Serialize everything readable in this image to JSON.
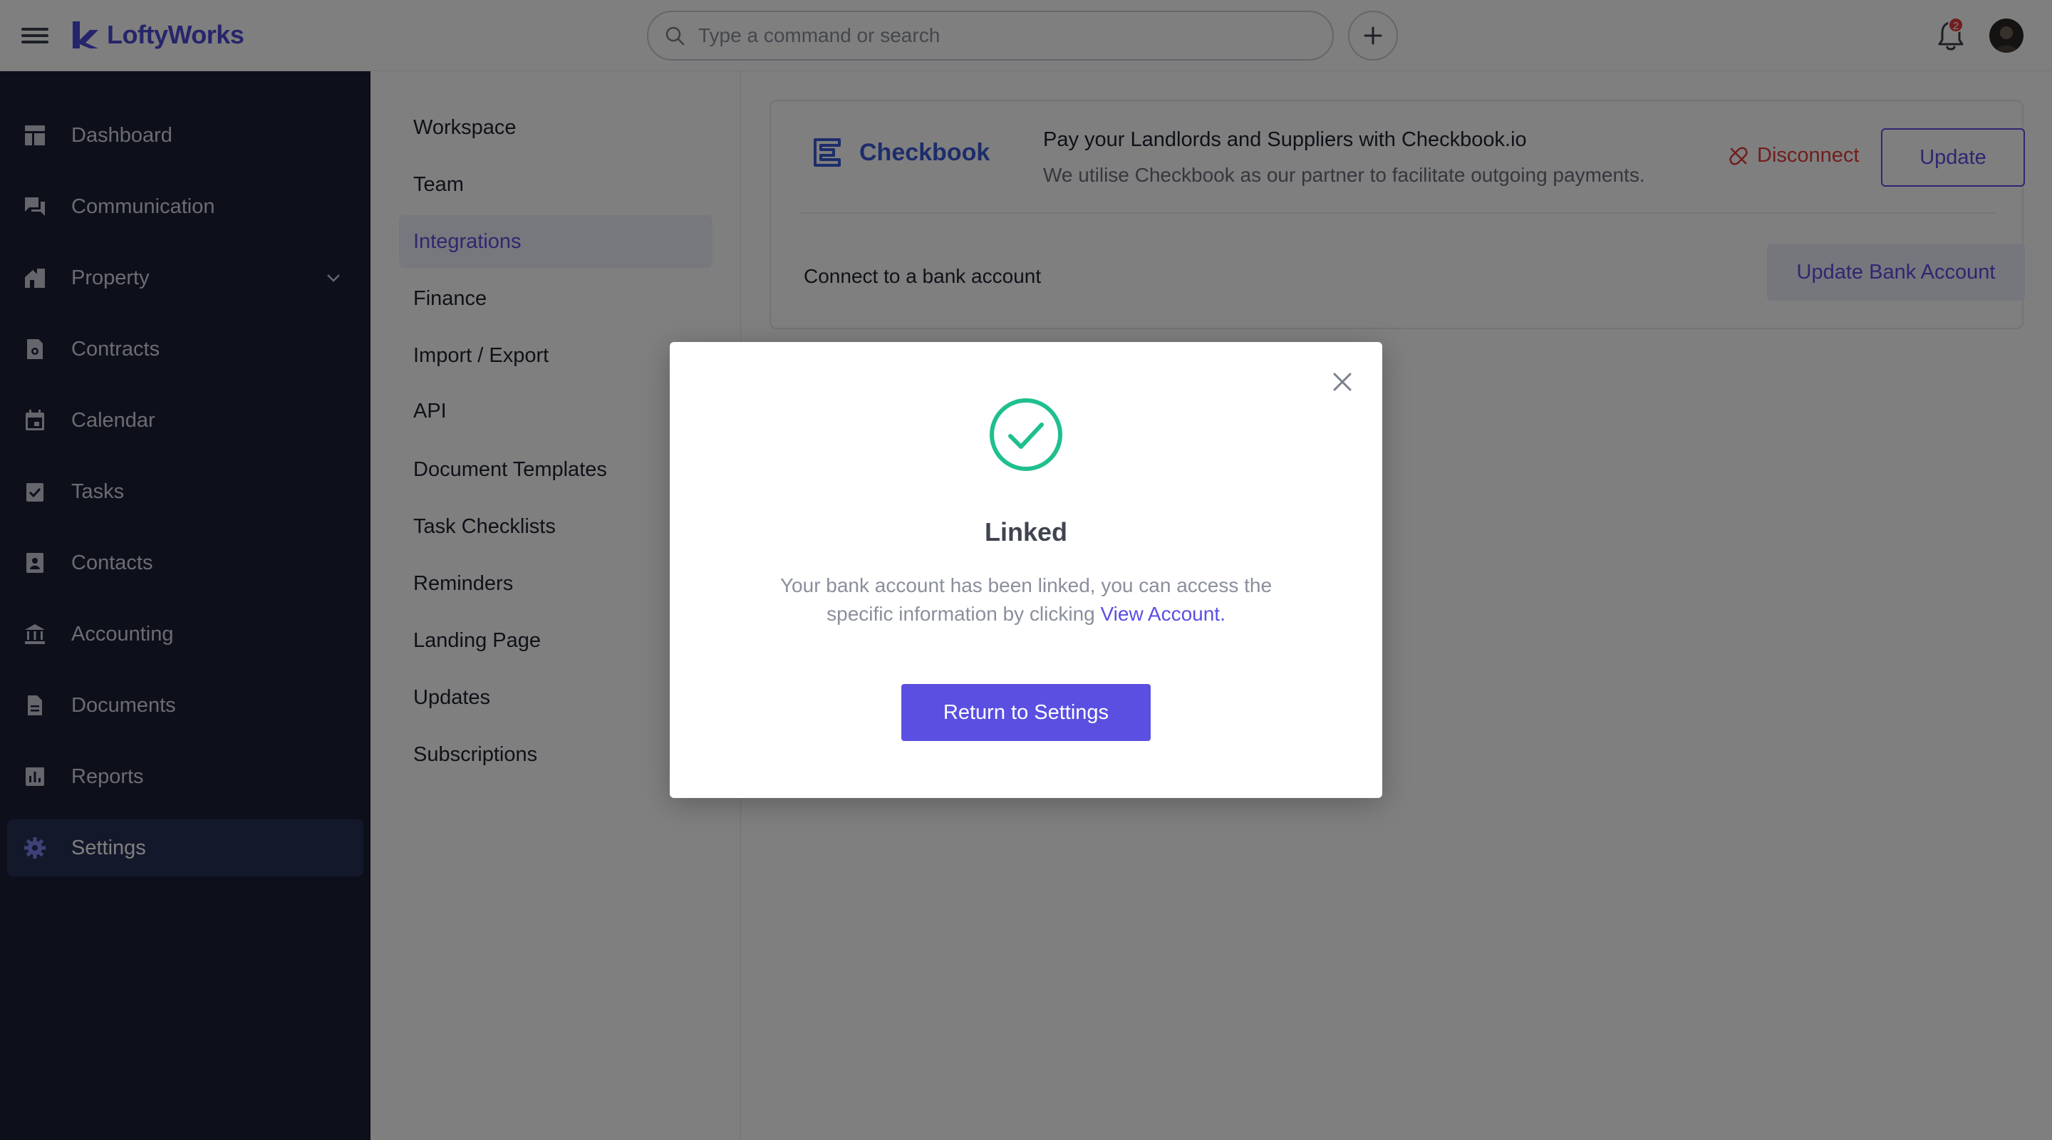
{
  "app": {
    "brand": "LoftyWorks",
    "accent_color": "#5a4fe0",
    "sidebar_color": "#1b2036"
  },
  "topbar": {
    "search_placeholder": "Type a command or search",
    "notification_count": "2"
  },
  "sidebar": {
    "items": [
      {
        "label": "Dashboard",
        "icon": "dashboard-icon"
      },
      {
        "label": "Communication",
        "icon": "chat-icon"
      },
      {
        "label": "Property",
        "icon": "property-icon"
      },
      {
        "label": "Contracts",
        "icon": "contract-icon"
      },
      {
        "label": "Calendar",
        "icon": "calendar-icon"
      },
      {
        "label": "Tasks",
        "icon": "tasks-icon"
      },
      {
        "label": "Contacts",
        "icon": "contacts-icon"
      },
      {
        "label": "Accounting",
        "icon": "bank-icon"
      },
      {
        "label": "Documents",
        "icon": "document-icon"
      },
      {
        "label": "Reports",
        "icon": "reports-icon"
      },
      {
        "label": "Settings",
        "icon": "gear-icon"
      }
    ],
    "active": "Settings"
  },
  "submenu": {
    "items": [
      {
        "label": "Workspace"
      },
      {
        "label": "Team"
      },
      {
        "label": "Integrations"
      },
      {
        "label": "Finance"
      },
      {
        "label": "Import / Export"
      },
      {
        "label": "API"
      },
      {
        "label": "Document Templates"
      },
      {
        "label": "Task Checklists"
      },
      {
        "label": "Reminders"
      },
      {
        "label": "Landing Page"
      },
      {
        "label": "Updates"
      },
      {
        "label": "Subscriptions"
      }
    ],
    "active": "Integrations"
  },
  "integration": {
    "name": "Checkbook",
    "title": "Pay your Landlords and Suppliers with Checkbook.io",
    "description": "We utilise Checkbook as our partner to facilitate outgoing payments.",
    "disconnect_label": "Disconnect",
    "update_label": "Update",
    "bank_label": "Connect to a bank account",
    "bank_button_label": "Update Bank Account",
    "brand_color": "#3b5bd6",
    "disconnect_color": "#e23b3b"
  },
  "modal": {
    "title": "Linked",
    "message_before": "Your bank account has been linked, you can access the specific information by clicking ",
    "link_text": "View Account",
    "message_after": ".",
    "button_label": "Return to Settings",
    "success_color": "#1fbf8f"
  }
}
